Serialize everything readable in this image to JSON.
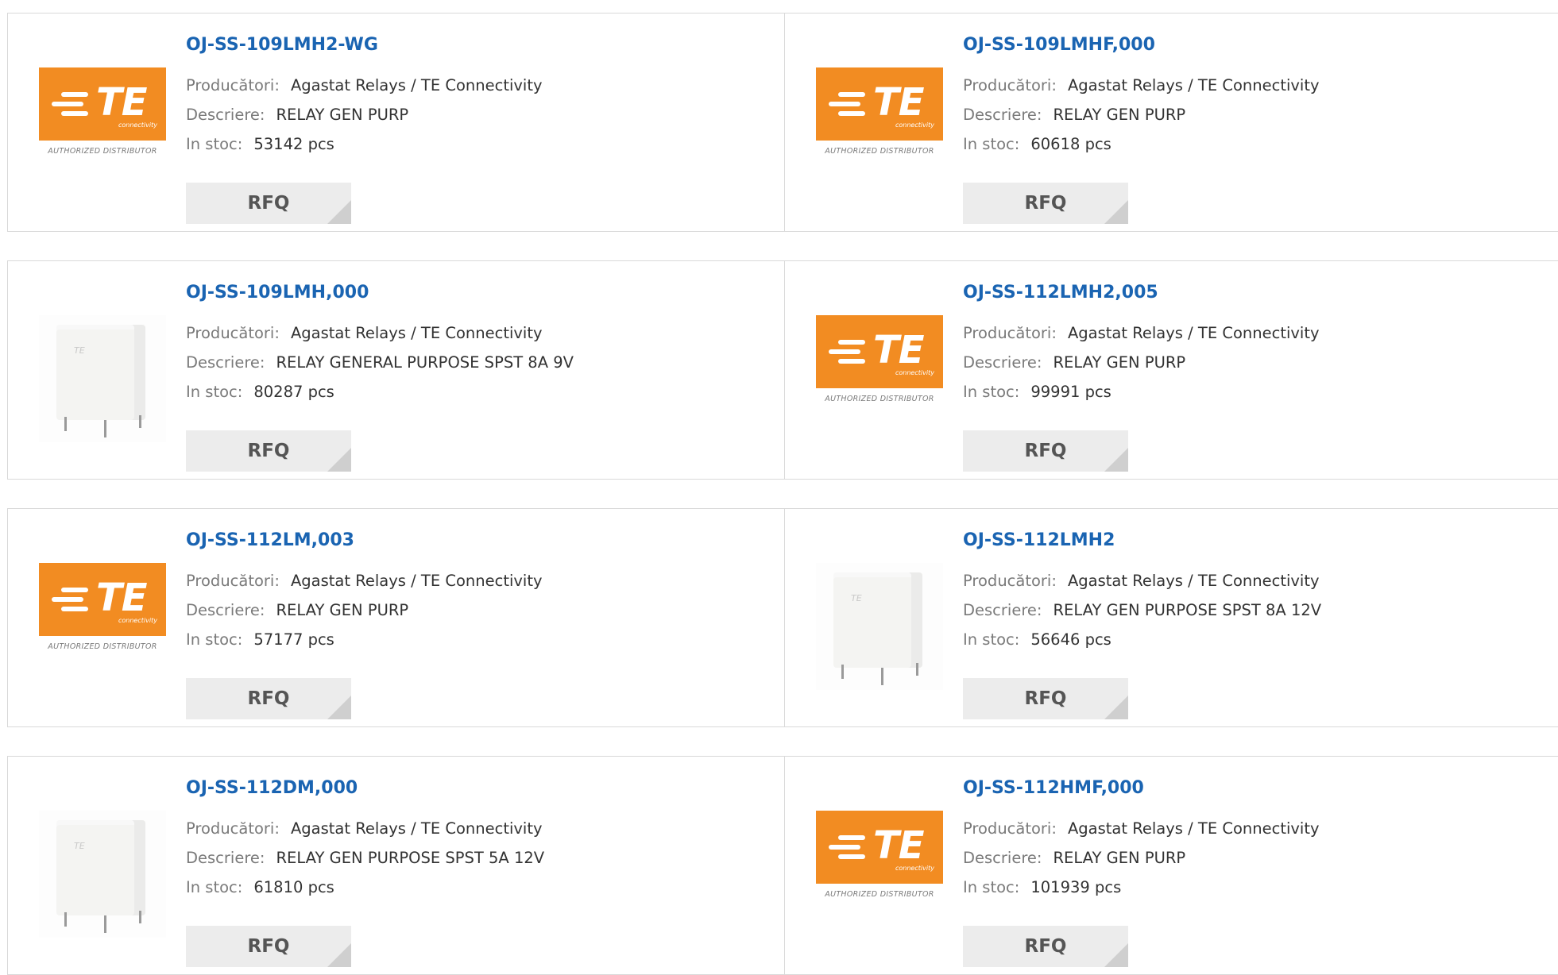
{
  "colors": {
    "accent": "#1a64b2",
    "brand_orange": "#f28c22",
    "button_bg": "#ececec",
    "border": "#d9d9d9"
  },
  "labels": {
    "manufacturer": "Producători:",
    "description": "Descriere:",
    "stock": "In stoc:",
    "rfq": "RFQ"
  },
  "te_logo": {
    "wordmark": "TE",
    "subtitle": "connectivity",
    "tagline": "AUTHORIZED DISTRIBUTOR"
  },
  "products": [
    {
      "part": "OJ-SS-109LMH2-WG",
      "manufacturer": "Agastat Relays / TE Connectivity",
      "description": "RELAY GEN PURP",
      "stock": "53142 pcs",
      "image": "te-logo"
    },
    {
      "part": "OJ-SS-109LMHF,000",
      "manufacturer": "Agastat Relays / TE Connectivity",
      "description": "RELAY GEN PURP",
      "stock": "60618 pcs",
      "image": "te-logo"
    },
    {
      "part": "OJ-SS-109LMH,000",
      "manufacturer": "Agastat Relays / TE Connectivity",
      "description": "RELAY GENERAL PURPOSE SPST 8A 9V",
      "stock": "80287 pcs",
      "image": "relay-photo"
    },
    {
      "part": "OJ-SS-112LMH2,005",
      "manufacturer": "Agastat Relays / TE Connectivity",
      "description": "RELAY GEN PURP",
      "stock": "99991 pcs",
      "image": "te-logo"
    },
    {
      "part": "OJ-SS-112LM,003",
      "manufacturer": "Agastat Relays / TE Connectivity",
      "description": "RELAY GEN PURP",
      "stock": "57177 pcs",
      "image": "te-logo"
    },
    {
      "part": "OJ-SS-112LMH2",
      "manufacturer": "Agastat Relays / TE Connectivity",
      "description": "RELAY GEN PURPOSE SPST 8A 12V",
      "stock": "56646 pcs",
      "image": "relay-photo"
    },
    {
      "part": "OJ-SS-112DM,000",
      "manufacturer": "Agastat Relays / TE Connectivity",
      "description": "RELAY GEN PURPOSE SPST 5A 12V",
      "stock": "61810 pcs",
      "image": "relay-photo"
    },
    {
      "part": "OJ-SS-112HMF,000",
      "manufacturer": "Agastat Relays / TE Connectivity",
      "description": "RELAY GEN PURP",
      "stock": "101939 pcs",
      "image": "te-logo"
    }
  ]
}
